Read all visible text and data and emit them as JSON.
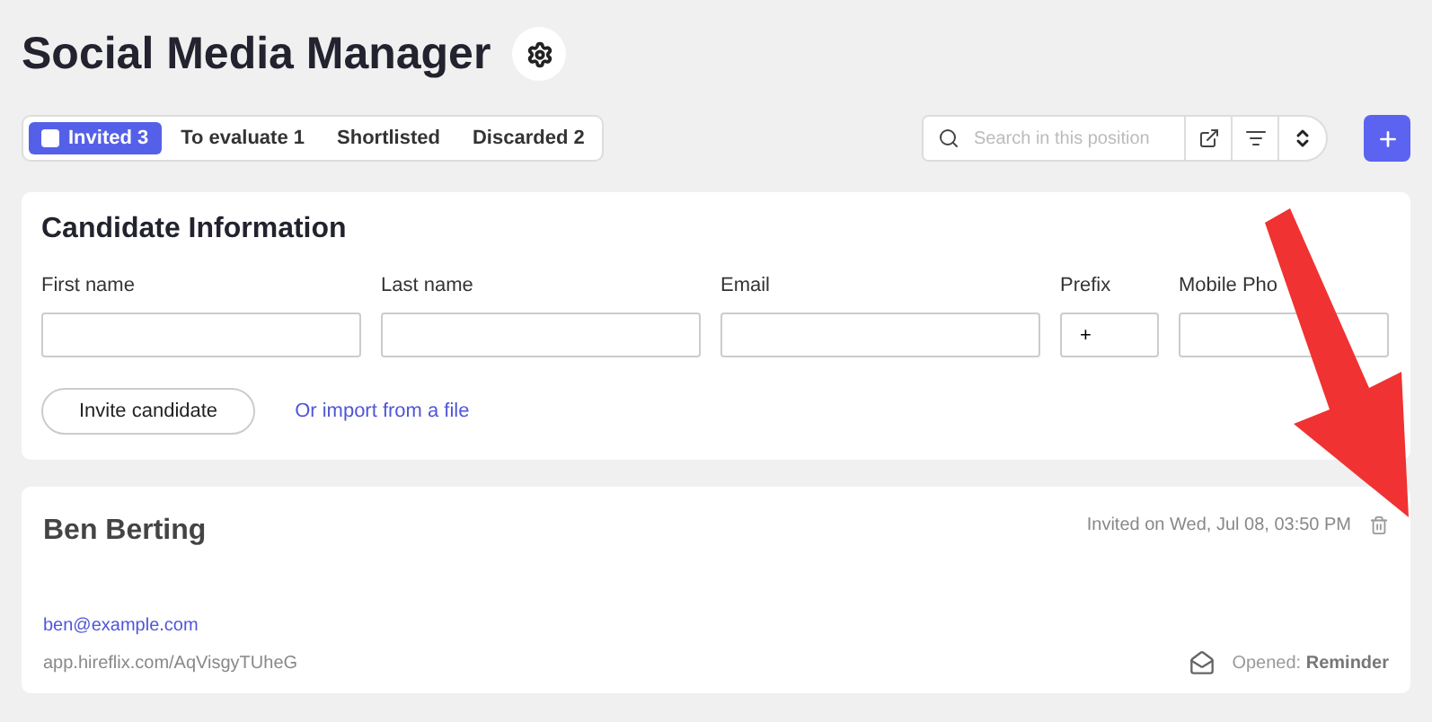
{
  "title": "Social Media Manager",
  "tabs": [
    {
      "label": "Invited 3",
      "selected": true
    },
    {
      "label": "To evaluate 1",
      "selected": false
    },
    {
      "label": "Shortlisted",
      "selected": false
    },
    {
      "label": "Discarded 2",
      "selected": false
    }
  ],
  "search": {
    "placeholder": "Search in this position"
  },
  "form": {
    "title": "Candidate Information",
    "fields": [
      {
        "label": "First name"
      },
      {
        "label": "Last name"
      },
      {
        "label": "Email"
      },
      {
        "label": "Prefix",
        "value": "+"
      },
      {
        "label": "Mobile Pho"
      }
    ],
    "invite_button": "Invite candidate",
    "import_link": "Or import from a file"
  },
  "candidate": {
    "name": "Ben Berting",
    "invited": "Invited on Wed, Jul 08, 03:50 PM",
    "email": "ben@example.com",
    "link": "app.hireflix.com/AqVisgyTUheG",
    "status": "Opened: **Reminder**"
  }
}
